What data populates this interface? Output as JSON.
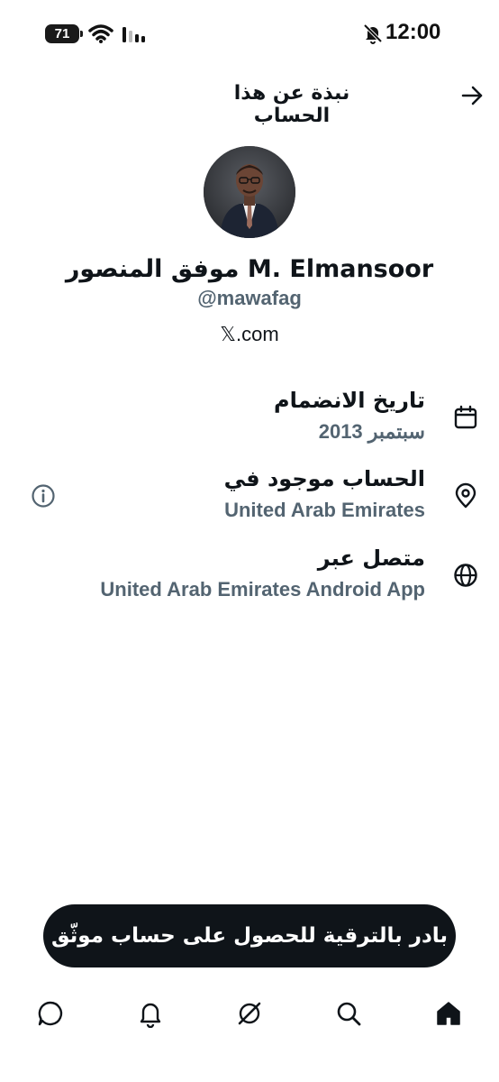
{
  "status_bar": {
    "battery_level": "71",
    "time": "12:00"
  },
  "header": {
    "title": "نبذة عن هذا الحساب"
  },
  "profile": {
    "display_name": "موفق المنصور M. Elmansoor",
    "handle": "@mawafag",
    "website": "𝕏.com"
  },
  "info": {
    "joined": {
      "label": "تاريخ الانضمام",
      "value": "سبتمبر 2013"
    },
    "location": {
      "label": "الحساب موجود في",
      "value": "United Arab Emirates"
    },
    "connected": {
      "label": "متصل عبر",
      "value": "United Arab Emirates Android App"
    }
  },
  "upgrade": {
    "label": "بادر بالترقية للحصول على حساب موثّق"
  },
  "nav": {
    "items": [
      "chat-icon",
      "bell-icon",
      "grok-icon",
      "search-icon",
      "home-icon"
    ]
  },
  "colors": {
    "primary_text": "#0f1419",
    "secondary_text": "#536471",
    "button_bg": "#0f1419"
  }
}
